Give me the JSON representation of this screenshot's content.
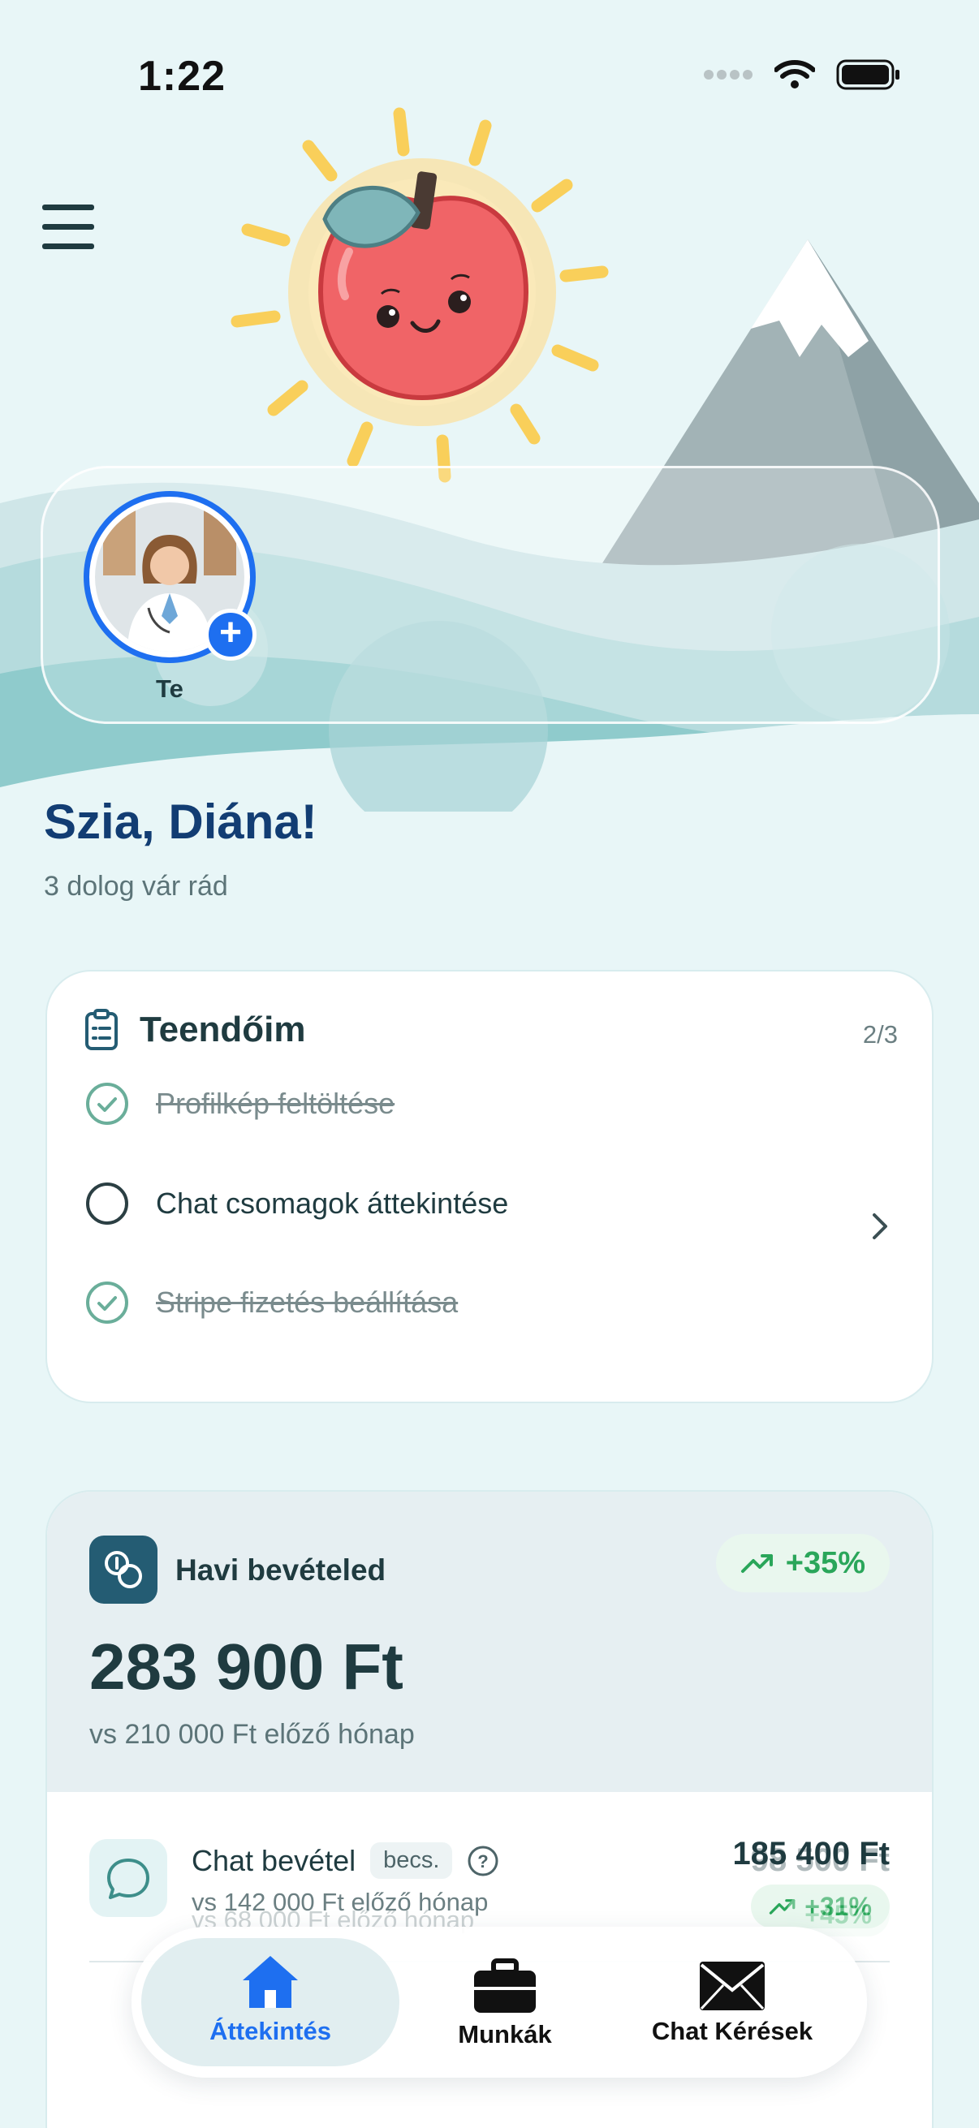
{
  "status_bar": {
    "time": "1:22"
  },
  "stories": [
    {
      "label": "Te"
    }
  ],
  "greeting": {
    "title": "Szia, Diána!",
    "subtitle": "3 dolog vár rád"
  },
  "todo": {
    "title": "Teendőim",
    "count": "2/3",
    "items": [
      {
        "label": "Profilkép feltöltése",
        "done": true
      },
      {
        "label": "Chat csomagok áttekintése",
        "done": false
      },
      {
        "label": "Stripe fizetés beállítása",
        "done": true
      }
    ]
  },
  "income": {
    "label": "Havi bevételed",
    "change": "+35%",
    "amount": "283 900 Ft",
    "previous": "vs 210 000 Ft előző hónap",
    "rows": [
      {
        "title": "Chat bevétel",
        "tag": "becs.",
        "previous": "vs 142 000 Ft előző hónap",
        "amount": "185 400 Ft",
        "change": "+31%"
      },
      {
        "title": "",
        "previous": "vs 68 000 Ft előző hónap",
        "amount": "98 500 Ft",
        "change": "+45%"
      }
    ]
  },
  "tabs": [
    {
      "label": "Áttekintés",
      "icon": "home-icon",
      "active": true
    },
    {
      "label": "Munkák",
      "icon": "briefcase-icon",
      "active": false
    },
    {
      "label": "Chat Kérések",
      "icon": "envelope-icon",
      "active": false
    }
  ],
  "colors": {
    "accent": "#1e6ff0",
    "dark_teal": "#245c73",
    "success": "#2aa65a",
    "title_blue": "#123d73"
  }
}
